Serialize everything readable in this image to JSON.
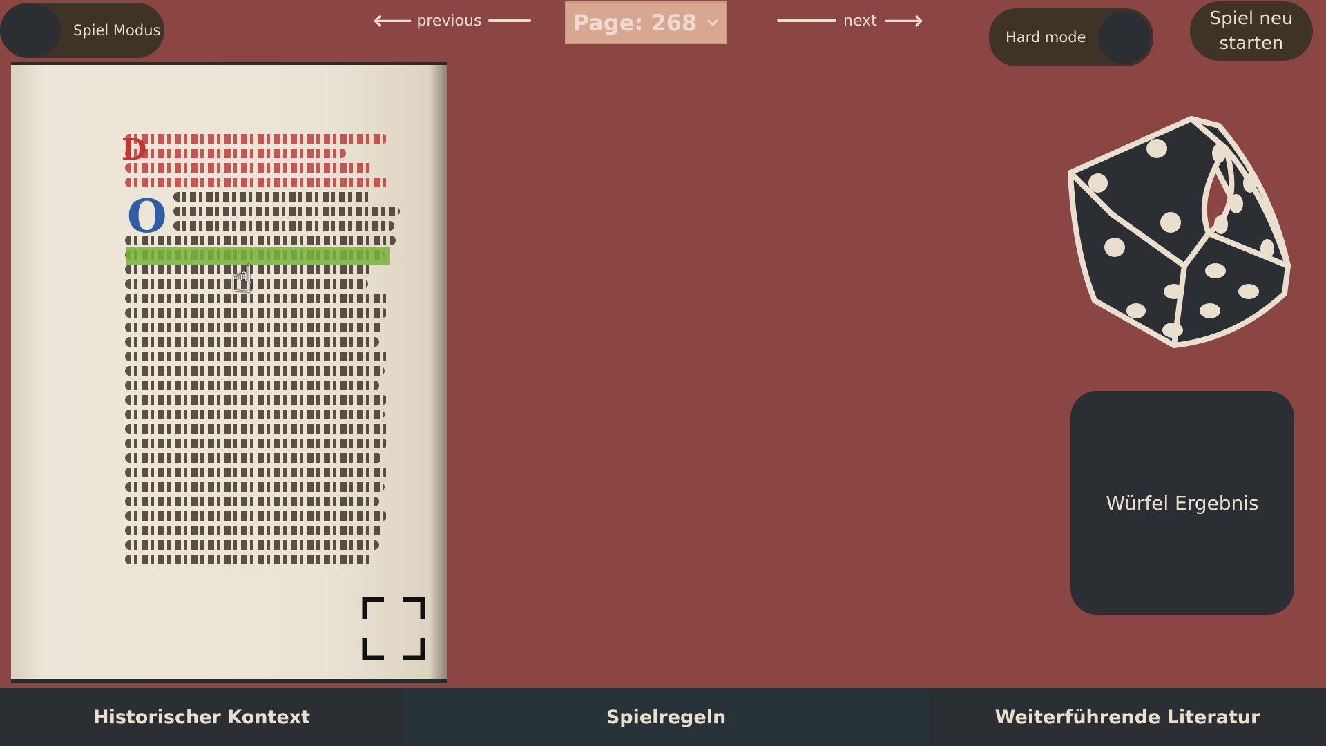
{
  "toggles": {
    "spiel_modus": "Spiel Modus",
    "hard_mode": "Hard mode"
  },
  "nav": {
    "previous": "previous",
    "next": "next",
    "page_select": "Page: 268"
  },
  "restart_button": "Spiel neu starten",
  "result_box": "Würfel Ergebnis",
  "bottom_tabs": {
    "historisch": "Historischer Kontext",
    "regeln": "Spielregeln",
    "literatur": "Weiterführende Literatur"
  },
  "colors": {
    "background": "#8b4543",
    "dark_panel": "#2b2f33",
    "toggle_bg": "#3e3326",
    "text": "#eadfcf",
    "highlight": "#78b43c"
  },
  "icons": [
    "arrow-left-icon",
    "arrow-right-icon",
    "chevron-down-icon",
    "fullscreen-icon",
    "dice-icon",
    "hand-cursor-icon"
  ]
}
